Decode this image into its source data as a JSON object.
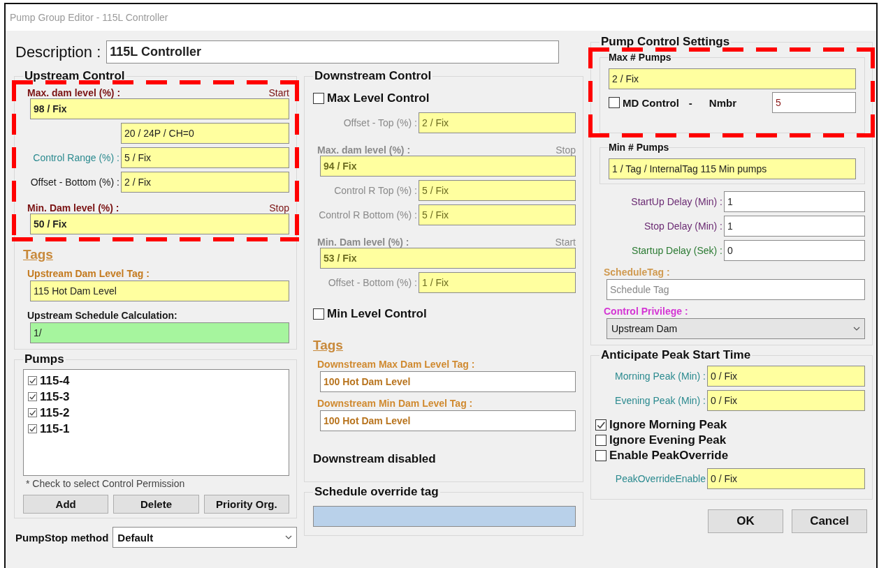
{
  "window": {
    "title": "Pump Group Editor - 115L Controller"
  },
  "description": {
    "label": "Description :",
    "field": {
      "value": "115L Controller",
      "color": "#ffffff"
    }
  },
  "columns": [
    {
      "blocks": [
        {
          "kind": "panel",
          "title": "Upstream Control",
          "sections": [
            {
              "highlighted": true,
              "items": [
                {
                  "kind": "level",
                  "label": "Max. dam level (%) :",
                  "hint": "Start",
                  "color": "#7a1212",
                  "field": {
                    "value": "98 / Fix",
                    "color": "#ffff9f"
                  }
                },
                {
                  "kind": "inline",
                  "field": {
                    "value": "20 / 24P / CH=0",
                    "color": "#ffff9f"
                  }
                },
                {
                  "kind": "inline",
                  "label": "Control Range (%) :",
                  "color": "#2b8a8f",
                  "field": {
                    "value": "5 / Fix",
                    "color": "#ffff9f"
                  }
                },
                {
                  "kind": "inline",
                  "label": "Offset - Bottom (%) :",
                  "color": "#1a1a1a",
                  "field": {
                    "value": "2 / Fix",
                    "color": "#ffff9f"
                  }
                },
                {
                  "kind": "level",
                  "label": "Min. Dam level (%) :",
                  "hint": "Stop",
                  "color": "#7a1212",
                  "field": {
                    "value": "50 / Fix",
                    "color": "#ffff9f"
                  }
                }
              ]
            },
            {
              "highlighted": false,
              "items": [
                {
                  "kind": "heading",
                  "label": "Tags",
                  "color": "#c8893a"
                },
                {
                  "kind": "stacked",
                  "label": "Upstream Dam Level Tag :",
                  "color": "#c47a1e",
                  "field": {
                    "value": "115 Hot Dam Level",
                    "color": "#ffff9f"
                  }
                },
                {
                  "kind": "stacked",
                  "label": "Upstream Schedule Calculation:",
                  "color": "#1a1a1a",
                  "field": {
                    "value": "1/",
                    "color": "#a6f59e"
                  }
                }
              ]
            }
          ]
        },
        {
          "kind": "panel",
          "title": "Pumps",
          "sections": [
            {
              "highlighted": false,
              "items": [
                {
                  "kind": "list",
                  "entries": [
                    {
                      "label": "115-4",
                      "checked": true
                    },
                    {
                      "label": "115-3",
                      "checked": true
                    },
                    {
                      "label": "115-2",
                      "checked": true
                    },
                    {
                      "label": "115-1",
                      "checked": true
                    }
                  ]
                },
                {
                  "kind": "note",
                  "label": "* Check to select Control Permission"
                },
                {
                  "kind": "buttons",
                  "labels": [
                    "Add",
                    "Delete",
                    "Priority Org."
                  ]
                }
              ]
            }
          ]
        },
        {
          "kind": "select",
          "label": "PumpStop method",
          "value": "Default"
        }
      ]
    },
    {
      "blocks": [
        {
          "kind": "panel",
          "title": "Downstream Control",
          "sections": [
            {
              "highlighted": false,
              "items": [
                {
                  "kind": "checkbox",
                  "label": "Max Level  Control",
                  "checked": false,
                  "disabled": false
                },
                {
                  "kind": "inline",
                  "label": "Offset - Top (%) :",
                  "disabled": true,
                  "field": {
                    "value": "2 / Fix",
                    "color": "#ffff9f"
                  }
                },
                {
                  "kind": "level",
                  "label": "Max. dam level (%) :",
                  "hint": "Stop",
                  "disabled": true,
                  "field": {
                    "value": "94 / Fix",
                    "color": "#ffff9f"
                  }
                },
                {
                  "kind": "inline",
                  "label": "Control R Top (%) :",
                  "disabled": true,
                  "field": {
                    "value": "5 / Fix",
                    "color": "#ffff9f"
                  }
                },
                {
                  "kind": "inline",
                  "label": "Control R Bottom (%) :",
                  "disabled": true,
                  "field": {
                    "value": "5 / Fix",
                    "color": "#ffff9f"
                  }
                },
                {
                  "kind": "level",
                  "label": "Min. Dam level (%) :",
                  "hint": "Start",
                  "disabled": true,
                  "field": {
                    "value": "53 / Fix",
                    "color": "#ffff9f"
                  }
                },
                {
                  "kind": "inline",
                  "label": "Offset - Bottom (%) :",
                  "disabled": true,
                  "field": {
                    "value": "1 / Fix",
                    "color": "#ffff9f"
                  }
                },
                {
                  "kind": "checkbox",
                  "label": "Min Level  Control",
                  "checked": false,
                  "disabled": false
                },
                {
                  "kind": "heading",
                  "label": "Tags",
                  "color": "#c8893a",
                  "disabled": false
                },
                {
                  "kind": "tag",
                  "label": "Downstream Max Dam Level Tag :",
                  "color": "#d08a30",
                  "disabled": false,
                  "field": {
                    "value": "100 Hot Dam Level",
                    "color": "#ffffff"
                  }
                },
                {
                  "kind": "tag",
                  "label": "Downstream Min Dam Level Tag :",
                  "color": "#d08a30",
                  "disabled": false,
                  "field": {
                    "value": "100 Hot Dam Level",
                    "color": "#ffffff"
                  }
                },
                {
                  "kind": "text",
                  "label": "Downstream disabled",
                  "disabled": false
                }
              ]
            }
          ]
        },
        {
          "kind": "panel",
          "title": "Schedule override tag",
          "sections": [
            {
              "highlighted": false,
              "items": [
                {
                  "kind": "stacked",
                  "field": {
                    "color": "#b9d1ea"
                  }
                }
              ]
            }
          ]
        }
      ]
    },
    {
      "blocks": [
        {
          "kind": "panel",
          "title": "Pump Control Settings",
          "sections": [
            {
              "highlighted": true,
              "items": [
                {
                  "kind": "subgroup",
                  "title": "Max # Pumps",
                  "items": [
                    {
                      "kind": "stacked",
                      "field": {
                        "value": "2 / Fix",
                        "color": "#ffff9f"
                      }
                    },
                    {
                      "kind": "checkbox_field",
                      "label": "MD Control",
                      "checked": false,
                      "parts": [
                        "-",
                        "Nmbr"
                      ],
                      "field": {
                        "value": "5",
                        "color": "#ffffff"
                      }
                    }
                  ]
                }
              ]
            },
            {
              "highlighted": false,
              "items": [
                {
                  "kind": "subgroup",
                  "title": "Min # Pumps",
                  "items": [
                    {
                      "kind": "stacked",
                      "field": {
                        "value": "1 / Tag / InternalTag 115 Min pumps",
                        "color": "#ffff9f"
                      }
                    }
                  ]
                },
                {
                  "kind": "inline",
                  "label": "StartUp Delay (Min) :",
                  "color": "#6a2a72",
                  "field": {
                    "value": "1",
                    "color": "#ffffff"
                  }
                },
                {
                  "kind": "inline",
                  "label": "Stop Delay (Min) :",
                  "color": "#6a2a72",
                  "field": {
                    "value": "1",
                    "color": "#ffffff"
                  }
                },
                {
                  "kind": "inline",
                  "label": "Startup Delay (Sek) :",
                  "color": "#2a7a32",
                  "field": {
                    "value": "0",
                    "color": "#ffffff"
                  }
                },
                {
                  "kind": "stacked",
                  "label": "ScheduleTag :",
                  "color": "#d09a50",
                  "field": {
                    "placeholder": "Schedule Tag",
                    "color": "#ffffff"
                  }
                },
                {
                  "kind": "select",
                  "label": "Control Privilege :",
                  "color": "#d435d4",
                  "value": "Upstream Dam"
                }
              ]
            }
          ]
        },
        {
          "kind": "panel",
          "title": "Anticipate Peak Start Time",
          "sections": [
            {
              "highlighted": false,
              "items": [
                {
                  "kind": "inline",
                  "label": "Morning Peak (Min) :",
                  "color": "#2b8a8f",
                  "field": {
                    "value": "0 / Fix",
                    "color": "#ffff9f"
                  }
                },
                {
                  "kind": "inline",
                  "label": "Evening Peak (Min) :",
                  "color": "#2b8a8f",
                  "field": {
                    "value": "0 / Fix",
                    "color": "#ffff9f"
                  }
                },
                {
                  "kind": "checkbox",
                  "label": "Ignore Morning Peak",
                  "checked": true
                },
                {
                  "kind": "checkbox",
                  "label": "Ignore Evening Peak",
                  "checked": false
                },
                {
                  "kind": "checkbox",
                  "label": "Enable PeakOverride",
                  "checked": false
                },
                {
                  "kind": "inline",
                  "label": "PeakOverrideEnable",
                  "color": "#2b8a8f",
                  "field": {
                    "value": "0 / Fix",
                    "color": "#ffff9f"
                  }
                }
              ]
            }
          ]
        },
        {
          "kind": "buttons",
          "labels": [
            "OK",
            "Cancel"
          ]
        }
      ]
    }
  ]
}
